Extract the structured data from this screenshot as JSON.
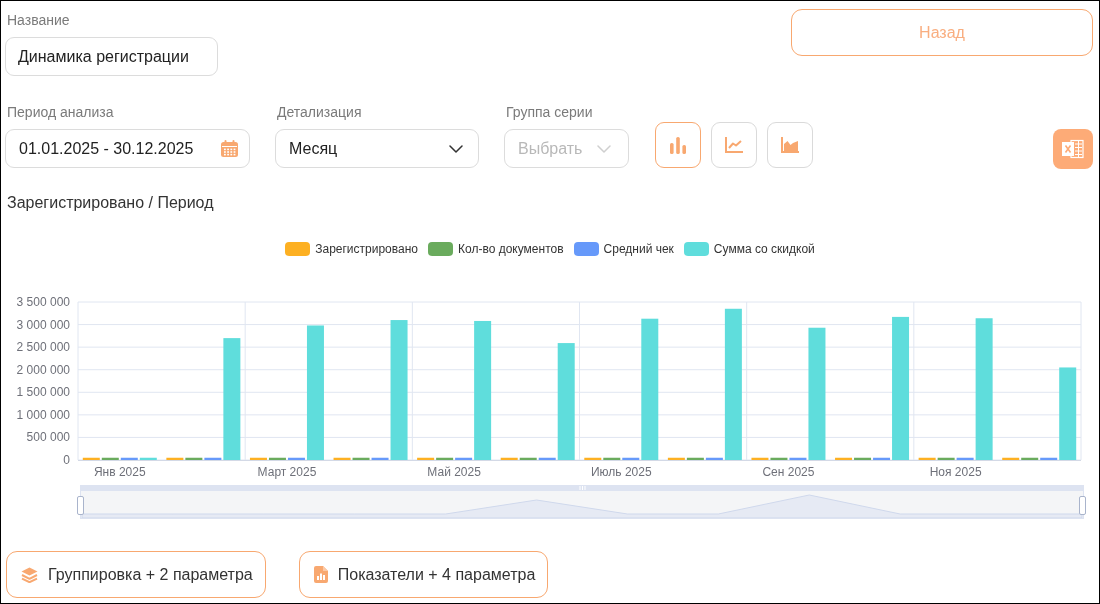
{
  "name_field": {
    "label": "Название",
    "value": "Динамика регистрации"
  },
  "back_button": {
    "label": "Назад"
  },
  "filters": [
    {
      "kind": "date",
      "label": "Период анализа",
      "value": "01.01.2025 - 30.12.2025",
      "disabled": false
    },
    {
      "kind": "select",
      "label": "Детализация",
      "value": "Месяц",
      "disabled": false
    },
    {
      "kind": "select",
      "label": "Группа серии",
      "placeholder": "Выбрать",
      "disabled": true
    }
  ],
  "chart_types": [
    {
      "kind": "bar",
      "selected": true
    },
    {
      "kind": "line",
      "selected": false
    },
    {
      "kind": "area",
      "selected": false
    }
  ],
  "chart": {
    "title": "Зарегистрировано / Период",
    "chart_data": {
      "type": "bar",
      "stacked": false,
      "grid": true,
      "categories": [
        "Янв 2025",
        null,
        "Март 2025",
        null,
        "Май 2025",
        null,
        "Июль 2025",
        null,
        "Сен 2025",
        null,
        "Ноя 2025",
        null
      ],
      "ylim": [
        0,
        3500000
      ],
      "yticks": [
        {
          "value": 0,
          "label": "0"
        },
        {
          "value": 500000,
          "label": "500 000"
        },
        {
          "value": 1000000,
          "label": "1 000 000"
        },
        {
          "value": 1500000,
          "label": "1 500 000"
        },
        {
          "value": 2000000,
          "label": "2 000 000"
        },
        {
          "value": 2500000,
          "label": "2 500 000"
        },
        {
          "value": 3000000,
          "label": "3 000 000"
        },
        {
          "value": 3500000,
          "label": "3 500 000"
        }
      ],
      "series": [
        {
          "name": "Зарегистрировано",
          "color": "#fdb022",
          "values": [
            50000,
            50000,
            50000,
            50000,
            50000,
            50000,
            50000,
            50000,
            50000,
            50000,
            50000,
            50000
          ]
        },
        {
          "name": "Кол-во документов",
          "color": "#6aab5d",
          "values": [
            50000,
            50000,
            50000,
            50000,
            50000,
            50000,
            50000,
            50000,
            50000,
            50000,
            50000,
            50000
          ]
        },
        {
          "name": "Средний чек",
          "color": "#6699fa",
          "values": [
            50000,
            50000,
            50000,
            50000,
            50000,
            50000,
            50000,
            50000,
            50000,
            50000,
            50000,
            50000
          ]
        },
        {
          "name": "Сумма со скидкой",
          "color": "#5fdddc",
          "values": [
            50000,
            2700000,
            2980000,
            3100000,
            3080000,
            2590000,
            3130000,
            3350000,
            2930000,
            3170000,
            3140000,
            2050000
          ]
        }
      ]
    }
  },
  "range_slider": {
    "level": 1
  },
  "footer_buttons": [
    {
      "kind": "grouping",
      "label": "Группировка + 2 параметра"
    },
    {
      "kind": "metrics",
      "label": "Показатели + 4 параметра"
    }
  ]
}
